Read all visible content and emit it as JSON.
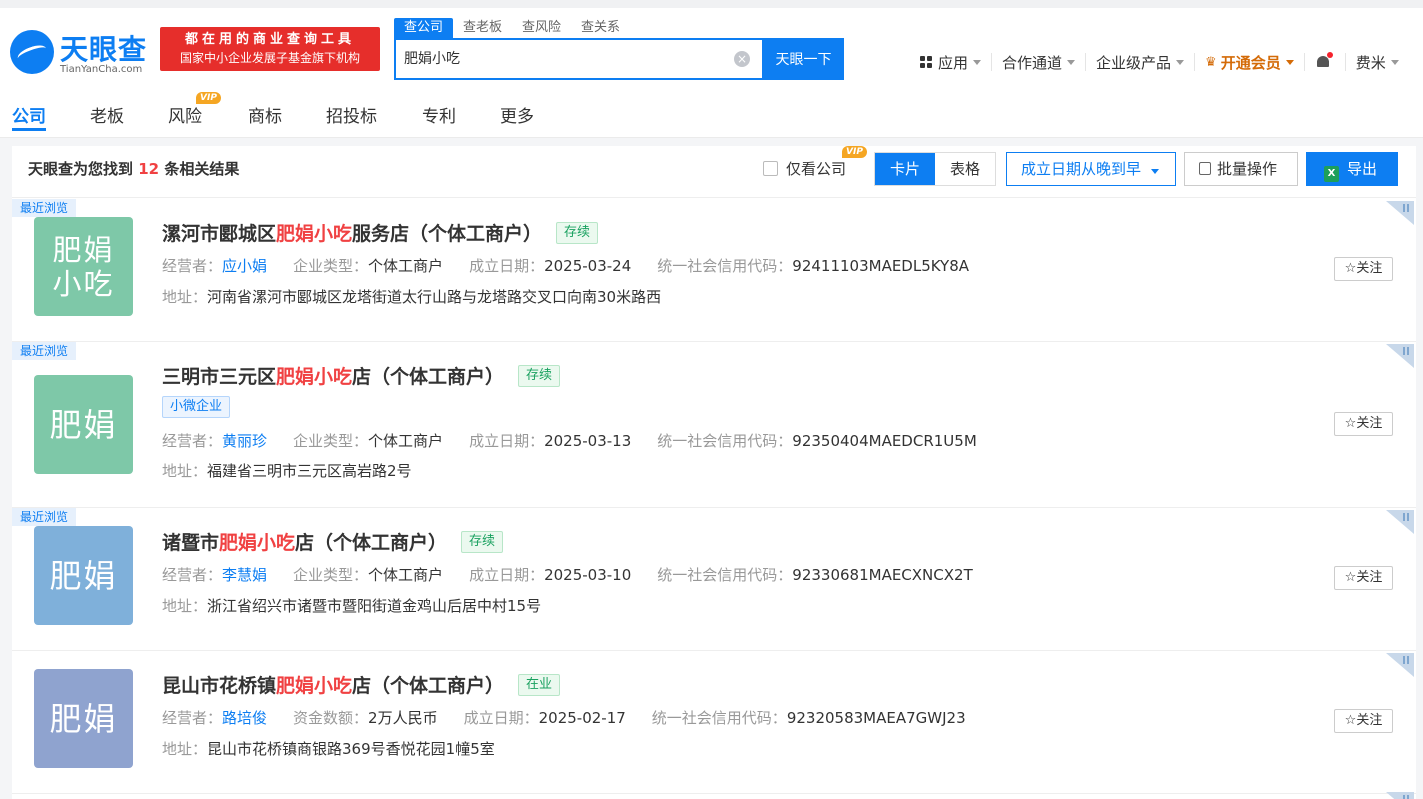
{
  "header": {
    "logo_text": "天眼查",
    "logo_sub": "TianYanCha.com",
    "banner_line1": "都在用的商业查询工具",
    "banner_line2": "国家中小企业发展子基金旗下机构",
    "search_tabs": [
      "查公司",
      "查老板",
      "查风险",
      "查关系"
    ],
    "search_value": "肥娟小吃",
    "search_clear": "×",
    "search_button": "天眼一下",
    "nav": {
      "apps": "应用",
      "cooperation": "合作通道",
      "enterprise": "企业级产品",
      "vip": "开通会员",
      "user": "费米"
    }
  },
  "category_tabs": [
    {
      "label": "公司"
    },
    {
      "label": "老板"
    },
    {
      "label": "风险",
      "vip": "VIP"
    },
    {
      "label": "商标"
    },
    {
      "label": "招投标"
    },
    {
      "label": "专利"
    },
    {
      "label": "更多"
    }
  ],
  "results_bar": {
    "prefix": "天眼查为您找到",
    "count": "12",
    "suffix": "条相关结果",
    "only_company": "仅看公司",
    "only_company_vip": "VIP",
    "view_card": "卡片",
    "view_table": "表格",
    "sort": "成立日期从晚到早",
    "batch": "批量操作",
    "export": "导出",
    "excel_icon": "X"
  },
  "results": [
    {
      "recent": "最近浏览",
      "avatar_line1": "肥娟",
      "avatar_line2": "小吃",
      "avatar_color": "#7ec8a8",
      "title_pre": "漯河市郾城区",
      "title_hl": "肥娟小吃",
      "title_post": "服务店（个体工商户）",
      "status": "存续",
      "meta": [
        {
          "k": "经营者：",
          "v": "应小娟"
        },
        {
          "k": "企业类型：",
          "v": "个体工商户"
        },
        {
          "k": "成立日期：",
          "v": "2025-03-24"
        },
        {
          "k": "统一社会信用代码：",
          "v": "92411103MAEDL5KY8A"
        }
      ],
      "addr_k": "地址：",
      "addr_v": "河南省漯河市郾城区龙塔街道太行山路与龙塔路交叉口向南30米路西",
      "follow": "关注"
    },
    {
      "recent": "最近浏览",
      "avatar_line1": "肥娟",
      "avatar_color": "#7ec8a8",
      "title_pre": "三明市三元区",
      "title_hl": "肥娟小吃",
      "title_post": "店（个体工商户）",
      "status": "存续",
      "badge": "小微企业",
      "meta": [
        {
          "k": "经营者：",
          "v": "黄丽珍"
        },
        {
          "k": "企业类型：",
          "v": "个体工商户"
        },
        {
          "k": "成立日期：",
          "v": "2025-03-13"
        },
        {
          "k": "统一社会信用代码：",
          "v": "92350404MAEDCR1U5M"
        }
      ],
      "addr_k": "地址：",
      "addr_v": "福建省三明市三元区高岩路2号",
      "follow": "关注"
    },
    {
      "recent": "最近浏览",
      "avatar_line1": "肥娟",
      "avatar_color": "#7fb0da",
      "title_pre": "诸暨市",
      "title_hl": "肥娟小吃",
      "title_post": "店（个体工商户）",
      "status": "存续",
      "meta": [
        {
          "k": "经营者：",
          "v": "李慧娟"
        },
        {
          "k": "企业类型：",
          "v": "个体工商户"
        },
        {
          "k": "成立日期：",
          "v": "2025-03-10"
        },
        {
          "k": "统一社会信用代码：",
          "v": "92330681MAECXNCX2T"
        }
      ],
      "addr_k": "地址：",
      "addr_v": "浙江省绍兴市诸暨市暨阳街道金鸡山后居中村15号",
      "follow": "关注"
    },
    {
      "avatar_line1": "肥娟",
      "avatar_color": "#8fa3cf",
      "title_pre": "昆山市花桥镇",
      "title_hl": "肥娟小吃",
      "title_post": "店（个体工商户）",
      "status": "在业",
      "meta": [
        {
          "k": "经营者：",
          "v": "路培俊"
        },
        {
          "k": "资金数额：",
          "v": "2万人民币"
        },
        {
          "k": "成立日期：",
          "v": "2025-02-17"
        },
        {
          "k": "统一社会信用代码：",
          "v": "92320583MAEA7GWJ23"
        }
      ],
      "addr_k": "地址：",
      "addr_v": "昆山市花桥镇商银路369号香悦花园1幢5室",
      "follow": "关注"
    }
  ]
}
